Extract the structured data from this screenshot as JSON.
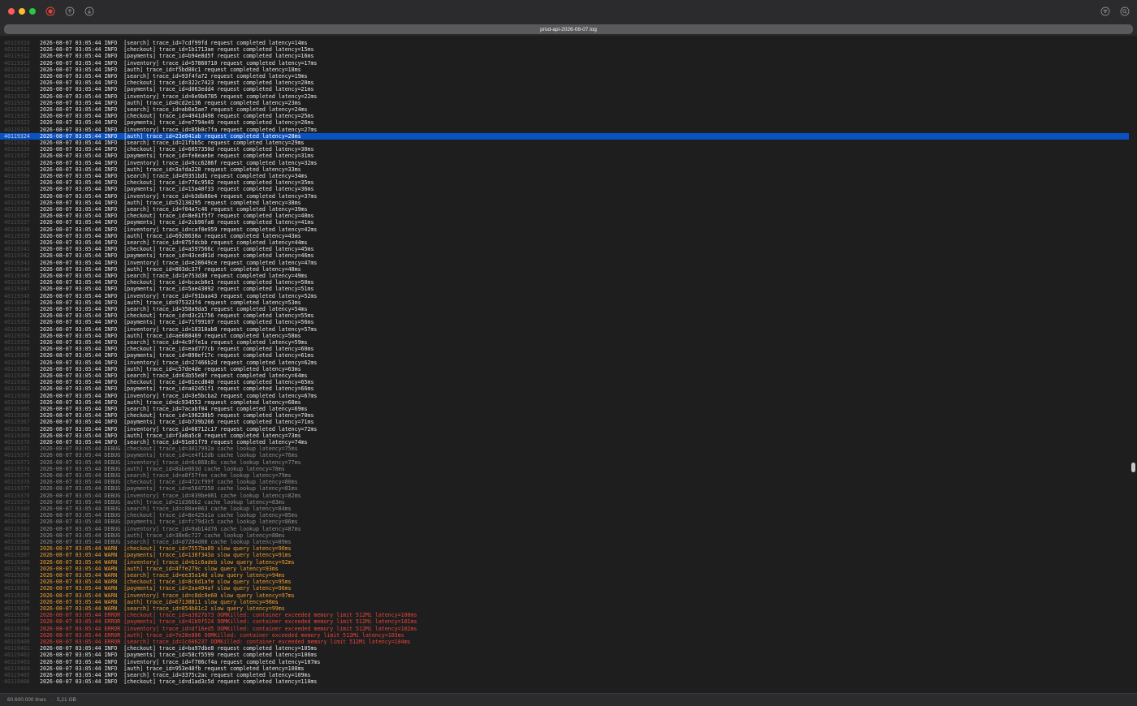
{
  "window": {
    "title": "prod-api-2026-08-07.log",
    "icons": [
      "record-icon",
      "scroll-up-icon",
      "scroll-down-icon",
      "filter-icon",
      "search-icon"
    ],
    "colors": {
      "info": "#e6e6e6",
      "debug": "#8e8e8e",
      "warn": "#f0a030",
      "error": "#e8443a",
      "selection": "#0a52c4"
    }
  },
  "log": {
    "selected_line": 40119324,
    "lines": [
      {
        "n": "40119310",
        "level": "INFO",
        "text": "2026-08-07 03:05:44 INFO  [search] trace_id=7cdf99fd request completed latency=14ms"
      },
      {
        "n": "40119311",
        "level": "INFO",
        "text": "2026-08-07 03:05:44 INFO  [checkout] trace_id=1b1713ae request completed latency=15ms"
      },
      {
        "n": "40119312",
        "level": "INFO",
        "text": "2026-08-07 03:05:44 INFO  [payments] trace_id=b94e8d5f request completed latency=16ms"
      },
      {
        "n": "40119313",
        "level": "INFO",
        "text": "2026-08-07 03:05:44 INFO  [inventory] trace_id=57860710 request completed latency=17ms"
      },
      {
        "n": "40119314",
        "level": "INFO",
        "text": "2026-08-07 03:05:44 INFO  [auth] trace_id=f5bd80c1 request completed latency=18ms"
      },
      {
        "n": "40119315",
        "level": "INFO",
        "text": "2026-08-07 03:05:44 INFO  [search] trace_id=93f4fa72 request completed latency=19ms"
      },
      {
        "n": "40119316",
        "level": "INFO",
        "text": "2026-08-07 03:05:44 INFO  [checkout] trace_id=322c7423 request completed latency=20ms"
      },
      {
        "n": "40119317",
        "level": "INFO",
        "text": "2026-08-07 03:05:44 INFO  [payments] trace_id=d063edd4 request completed latency=21ms"
      },
      {
        "n": "40119318",
        "level": "INFO",
        "text": "2026-08-07 03:05:44 INFO  [inventory] trace_id=6e9b6785 request completed latency=22ms"
      },
      {
        "n": "40119319",
        "level": "INFO",
        "text": "2026-08-07 03:05:44 INFO  [auth] trace_id=0cd2e136 request completed latency=23ms"
      },
      {
        "n": "40119320",
        "level": "INFO",
        "text": "2026-08-07 03:05:44 INFO  [search] trace_id=ab0a5ae7 request completed latency=24ms"
      },
      {
        "n": "40119321",
        "level": "INFO",
        "text": "2026-08-07 03:05:44 INFO  [checkout] trace_id=4941d498 request completed latency=25ms"
      },
      {
        "n": "40119322",
        "level": "INFO",
        "text": "2026-08-07 03:05:44 INFO  [payments] trace_id=e7794e49 request completed latency=26ms"
      },
      {
        "n": "40119323",
        "level": "INFO",
        "text": "2026-08-07 03:05:44 INFO  [inventory] trace_id=85b0c7fa request completed latency=27ms"
      },
      {
        "n": "40119324",
        "level": "INFO",
        "text": "2026-08-07 03:05:44 INFO  [auth] trace_id=23e041ab request completed latency=28ms"
      },
      {
        "n": "40119325",
        "level": "INFO",
        "text": "2026-08-07 03:05:44 INFO  [search] trace_id=21fbb5c request completed latency=29ms"
      },
      {
        "n": "40119326",
        "level": "INFO",
        "text": "2026-08-07 03:05:44 INFO  [checkout] trace_id=6057350d request completed latency=30ms"
      },
      {
        "n": "40119327",
        "level": "INFO",
        "text": "2026-08-07 03:05:44 INFO  [payments] trace_id=fe8eaebe request completed latency=31ms"
      },
      {
        "n": "40119328",
        "level": "INFO",
        "text": "2026-08-07 03:05:44 INFO  [inventory] trace_id=9cc6286f request completed latency=32ms"
      },
      {
        "n": "40119329",
        "level": "INFO",
        "text": "2026-08-07 03:05:44 INFO  [auth] trace_id=3afda220 request completed latency=33ms"
      },
      {
        "n": "40119330",
        "level": "INFO",
        "text": "2026-08-07 03:05:44 INFO  [search] trace_id=d9351bd1 request completed latency=34ms"
      },
      {
        "n": "40119331",
        "level": "INFO",
        "text": "2026-08-07 03:05:44 INFO  [checkout] trace_id=776c9582 request completed latency=35ms"
      },
      {
        "n": "40119332",
        "level": "INFO",
        "text": "2026-08-07 03:05:44 INFO  [payments] trace_id=15a40f33 request completed latency=36ms"
      },
      {
        "n": "40119333",
        "level": "INFO",
        "text": "2026-08-07 03:05:44 INFO  [inventory] trace_id=b3db88e4 request completed latency=37ms"
      },
      {
        "n": "40119334",
        "level": "INFO",
        "text": "2026-08-07 03:05:44 INFO  [auth] trace_id=52130295 request completed latency=38ms"
      },
      {
        "n": "40119335",
        "level": "INFO",
        "text": "2026-08-07 03:05:44 INFO  [search] trace_id=f04a7c46 request completed latency=39ms"
      },
      {
        "n": "40119336",
        "level": "INFO",
        "text": "2026-08-07 03:05:44 INFO  [checkout] trace_id=8e01f5f7 request completed latency=40ms"
      },
      {
        "n": "40119337",
        "level": "INFO",
        "text": "2026-08-07 03:05:44 INFO  [payments] trace_id=2cb96fa8 request completed latency=41ms"
      },
      {
        "n": "40119338",
        "level": "INFO",
        "text": "2026-08-07 03:05:44 INFO  [inventory] trace_id=caf0e959 request completed latency=42ms"
      },
      {
        "n": "40119339",
        "level": "INFO",
        "text": "2026-08-07 03:05:44 INFO  [auth] trace_id=6928630a request completed latency=43ms"
      },
      {
        "n": "40119340",
        "level": "INFO",
        "text": "2026-08-07 03:05:44 INFO  [search] trace_id=075fdcbb request completed latency=44ms"
      },
      {
        "n": "40119341",
        "level": "INFO",
        "text": "2026-08-07 03:05:44 INFO  [checkout] trace_id=a597566c request completed latency=45ms"
      },
      {
        "n": "40119342",
        "level": "INFO",
        "text": "2026-08-07 03:05:44 INFO  [payments] trace_id=43ced01d request completed latency=46ms"
      },
      {
        "n": "40119343",
        "level": "INFO",
        "text": "2026-08-07 03:05:44 INFO  [inventory] trace_id=e20649ce request completed latency=47ms"
      },
      {
        "n": "40119344",
        "level": "INFO",
        "text": "2026-08-07 03:05:44 INFO  [auth] trace_id=803dc37f request completed latency=48ms"
      },
      {
        "n": "40119345",
        "level": "INFO",
        "text": "2026-08-07 03:05:44 INFO  [search] trace_id=1e753d30 request completed latency=49ms"
      },
      {
        "n": "40119346",
        "level": "INFO",
        "text": "2026-08-07 03:05:44 INFO  [checkout] trace_id=bcacb6e1 request completed latency=50ms"
      },
      {
        "n": "40119347",
        "level": "INFO",
        "text": "2026-08-07 03:05:44 INFO  [payments] trace_id=5ae43092 request completed latency=51ms"
      },
      {
        "n": "40119348",
        "level": "INFO",
        "text": "2026-08-07 03:05:44 INFO  [inventory] trace_id=f91baa43 request completed latency=52ms"
      },
      {
        "n": "40119349",
        "level": "INFO",
        "text": "2026-08-07 03:05:44 INFO  [auth] trace_id=975323f4 request completed latency=53ms"
      },
      {
        "n": "40119350",
        "level": "INFO",
        "text": "2026-08-07 03:05:44 INFO  [search] trace_id=358a9da5 request completed latency=54ms"
      },
      {
        "n": "40119351",
        "level": "INFO",
        "text": "2026-08-07 03:05:44 INFO  [checkout] trace_id=d3c21756 request completed latency=55ms"
      },
      {
        "n": "40119352",
        "level": "INFO",
        "text": "2026-08-07 03:05:44 INFO  [payments] trace_id=71f99107 request completed latency=56ms"
      },
      {
        "n": "40119353",
        "level": "INFO",
        "text": "2026-08-07 03:05:44 INFO  [inventory] trace_id=10310ab8 request completed latency=57ms"
      },
      {
        "n": "40119354",
        "level": "INFO",
        "text": "2026-08-07 03:05:44 INFO  [auth] trace_id=ae688469 request completed latency=58ms"
      },
      {
        "n": "40119355",
        "level": "INFO",
        "text": "2026-08-07 03:05:44 INFO  [search] trace_id=4c9ffe1a request completed latency=59ms"
      },
      {
        "n": "40119356",
        "level": "INFO",
        "text": "2026-08-07 03:05:44 INFO  [checkout] trace_id=ead777cb request completed latency=60ms"
      },
      {
        "n": "40119357",
        "level": "INFO",
        "text": "2026-08-07 03:05:44 INFO  [payments] trace_id=890ef17c request completed latency=61ms"
      },
      {
        "n": "40119358",
        "level": "INFO",
        "text": "2026-08-07 03:05:44 INFO  [inventory] trace_id=27466b2d request completed latency=62ms"
      },
      {
        "n": "40119359",
        "level": "INFO",
        "text": "2026-08-07 03:05:44 INFO  [auth] trace_id=c57de4de request completed latency=63ms"
      },
      {
        "n": "40119360",
        "level": "INFO",
        "text": "2026-08-07 03:05:44 INFO  [search] trace_id=63b55e8f request completed latency=64ms"
      },
      {
        "n": "40119361",
        "level": "INFO",
        "text": "2026-08-07 03:05:44 INFO  [checkout] trace_id=01ecd840 request completed latency=65ms"
      },
      {
        "n": "40119362",
        "level": "INFO",
        "text": "2026-08-07 03:05:44 INFO  [payments] trace_id=a02451f1 request completed latency=66ms"
      },
      {
        "n": "40119363",
        "level": "INFO",
        "text": "2026-08-07 03:05:44 INFO  [inventory] trace_id=3e5bcba2 request completed latency=67ms"
      },
      {
        "n": "40119364",
        "level": "INFO",
        "text": "2026-08-07 03:05:44 INFO  [auth] trace_id=dc934553 request completed latency=68ms"
      },
      {
        "n": "40119365",
        "level": "INFO",
        "text": "2026-08-07 03:05:44 INFO  [search] trace_id=7acabf04 request completed latency=69ms"
      },
      {
        "n": "40119366",
        "level": "INFO",
        "text": "2026-08-07 03:05:44 INFO  [checkout] trace_id=190238b5 request completed latency=70ms"
      },
      {
        "n": "40119367",
        "level": "INFO",
        "text": "2026-08-07 03:05:44 INFO  [payments] trace_id=b739b266 request completed latency=71ms"
      },
      {
        "n": "40119368",
        "level": "INFO",
        "text": "2026-08-07 03:05:44 INFO  [inventory] trace_id=66712c17 request completed latency=72ms"
      },
      {
        "n": "40119369",
        "level": "INFO",
        "text": "2026-08-07 03:05:44 INFO  [auth] trace_id=f3a8a5c8 request completed latency=73ms"
      },
      {
        "n": "40119370",
        "level": "INFO",
        "text": "2026-08-07 03:05:44 INFO  [search] trace_id=91e01f79 request completed latency=74ms"
      },
      {
        "n": "40119371",
        "level": "DEBUG",
        "text": "2026-08-07 03:05:44 DEBUG [checkout] trace_id=3017992a cache lookup latency=75ms"
      },
      {
        "n": "40119372",
        "level": "DEBUG",
        "text": "2026-08-07 03:05:44 DEBUG [payments] trace_id=ce4f12db cache lookup latency=76ms"
      },
      {
        "n": "40119373",
        "level": "DEBUG",
        "text": "2026-08-07 03:05:44 DEBUG [inventory] trace_id=6c868c8c cache lookup latency=77ms"
      },
      {
        "n": "40119374",
        "level": "DEBUG",
        "text": "2026-08-07 03:05:44 DEBUG [auth] trace_id=8abe063d cache lookup latency=78ms"
      },
      {
        "n": "40119375",
        "level": "DEBUG",
        "text": "2026-08-07 03:05:44 DEBUG [search] trace_id=a8f57fee cache lookup latency=79ms"
      },
      {
        "n": "40119376",
        "level": "DEBUG",
        "text": "2026-08-07 03:05:44 DEBUG [checkout] trace_id=472cf99f cache lookup latency=80ms"
      },
      {
        "n": "40119377",
        "level": "DEBUG",
        "text": "2026-08-07 03:05:44 DEBUG [payments] trace_id=e5647350 cache lookup latency=81ms"
      },
      {
        "n": "40119378",
        "level": "DEBUG",
        "text": "2026-08-07 03:05:44 DEBUG [inventory] trace_id=839be081 cache lookup latency=82ms"
      },
      {
        "n": "40119379",
        "level": "DEBUG",
        "text": "2026-08-07 03:05:44 DEBUG [auth] trace_id=21d366b2 cache lookup latency=83ms"
      },
      {
        "n": "40119380",
        "level": "DEBUG",
        "text": "2026-08-07 03:05:44 DEBUG [search] trace_id=c00ae063 cache lookup latency=84ms"
      },
      {
        "n": "40119381",
        "level": "DEBUG",
        "text": "2026-08-07 03:05:44 DEBUG [checkout] trace_id=8e425a1a cache lookup latency=85ms"
      },
      {
        "n": "40119382",
        "level": "DEBUG",
        "text": "2026-08-07 03:05:44 DEBUG [payments] trace_id=fc79d3c5 cache lookup latency=86ms"
      },
      {
        "n": "40119383",
        "level": "DEBUG",
        "text": "2026-08-07 03:05:44 DEBUG [inventory] trace_id=9ab14d76 cache lookup latency=87ms"
      },
      {
        "n": "40119384",
        "level": "DEBUG",
        "text": "2026-08-07 03:05:44 DEBUG [auth] trace_id=38e8c727 cache lookup latency=88ms"
      },
      {
        "n": "40119385",
        "level": "DEBUG",
        "text": "2026-08-07 03:05:44 DEBUG [search] trace_id=d7284d08 cache lookup latency=89ms"
      },
      {
        "n": "40119386",
        "level": "WARN",
        "text": "2026-08-07 03:05:44 WARN  [checkout] trace_id=7557ba89 slow query latency=90ms"
      },
      {
        "n": "40119387",
        "level": "WARN",
        "text": "2026-08-07 03:05:44 WARN  [payments] trace_id=138f343a slow query latency=91ms"
      },
      {
        "n": "40119388",
        "level": "WARN",
        "text": "2026-08-07 03:05:44 WARN  [inventory] trace_id=b1c6adeb slow query latency=92ms"
      },
      {
        "n": "40119389",
        "level": "WARN",
        "text": "2026-08-07 03:05:44 WARN  [auth] trace_id=4ffe279c slow query latency=93ms"
      },
      {
        "n": "40119390",
        "level": "WARN",
        "text": "2026-08-07 03:05:44 WARN  [search] trace_id=ee35a14d slow query latency=94ms"
      },
      {
        "n": "40119391",
        "level": "WARN",
        "text": "2026-08-07 03:05:44 WARN  [checkout] trace_id=8c6d1afe slow query latency=95ms"
      },
      {
        "n": "40119392",
        "level": "WARN",
        "text": "2026-08-07 03:05:44 WARN  [payments] trace_id=2aa494af slow query latency=96ms"
      },
      {
        "n": "40119393",
        "level": "WARN",
        "text": "2026-08-07 03:05:44 WARN  [inventory] trace_id=c8dc0e60 slow query latency=97ms"
      },
      {
        "n": "40119394",
        "level": "WARN",
        "text": "2026-08-07 03:05:44 WARN  [auth] trace_id=67138811 slow query latency=98ms"
      },
      {
        "n": "40119395",
        "level": "WARN",
        "text": "2026-08-07 03:05:44 WARN  [search] trace_id=054b01c2 slow query latency=99ms"
      },
      {
        "n": "40119396",
        "level": "ERROR",
        "text": "2026-08-07 03:05:44 ERROR [checkout] trace_id=a3827b73 OOMKilled: container exceeded memory limit 512Mi latency=100ms"
      },
      {
        "n": "40119397",
        "level": "ERROR",
        "text": "2026-08-07 03:05:44 ERROR [payments] trace_id=41b9f524 OOMKilled: container exceeded memory limit 512Mi latency=101ms"
      },
      {
        "n": "40119398",
        "level": "ERROR",
        "text": "2026-08-07 03:05:44 ERROR [inventory] trace_id=df16ed5 OOMKilled: container exceeded memory limit 512Mi latency=102ms"
      },
      {
        "n": "40119399",
        "level": "ERROR",
        "text": "2026-08-07 03:05:44 ERROR [auth] trace_id=7e28e886 OOMKilled: container exceeded memory limit 512Mi latency=103ms"
      },
      {
        "n": "40119400",
        "level": "ERROR",
        "text": "2026-08-07 03:05:44 ERROR [search] trace_id=1c606237 OOMKilled: container exceeded memory limit 512Mi latency=104ms"
      },
      {
        "n": "40119401",
        "level": "INFO",
        "text": "2026-08-07 03:05:44 INFO  [checkout] trace_id=ba97dbe8 request completed latency=105ms"
      },
      {
        "n": "40119402",
        "level": "INFO",
        "text": "2026-08-07 03:05:44 INFO  [payments] trace_id=58cf5599 request completed latency=106ms"
      },
      {
        "n": "40119403",
        "level": "INFO",
        "text": "2026-08-07 03:05:44 INFO  [inventory] trace_id=f706cf4a request completed latency=107ms"
      },
      {
        "n": "40119404",
        "level": "INFO",
        "text": "2026-08-07 03:05:44 INFO  [auth] trace_id=953e48fb request completed latency=108ms"
      },
      {
        "n": "40119405",
        "level": "INFO",
        "text": "2026-08-07 03:05:44 INFO  [search] trace_id=3375c2ac request completed latency=109ms"
      },
      {
        "n": "40119406",
        "level": "INFO",
        "text": "2026-08-07 03:05:44 INFO  [checkout] trace_id=d1ad3c5d request completed latency=110ms"
      }
    ]
  },
  "status": {
    "line_count": "60.600.000 lines",
    "separator": "·",
    "file_size": "5,21 GB"
  }
}
